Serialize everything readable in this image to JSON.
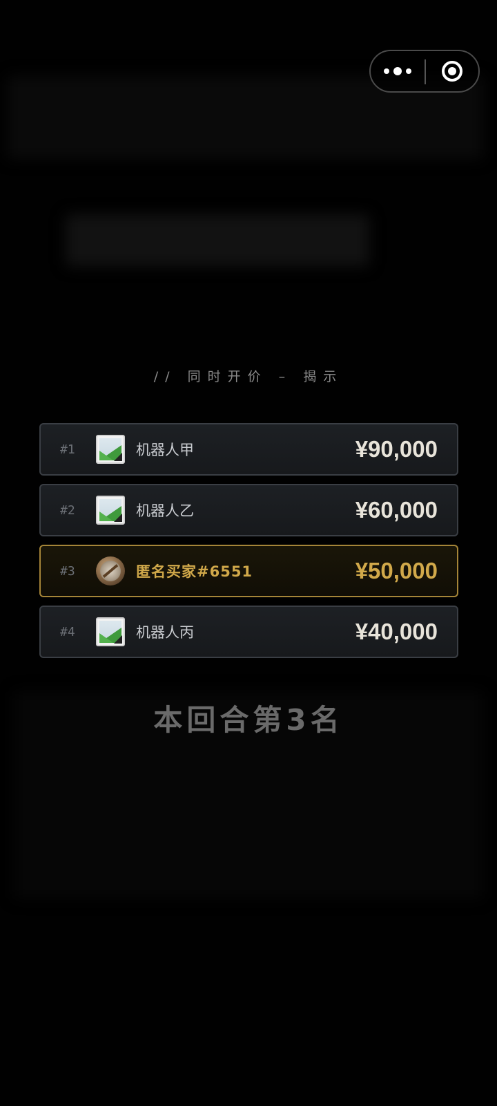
{
  "capsule": {
    "more_icon": "more-dots-icon",
    "close_icon": "target-circle-icon"
  },
  "reveal": {
    "title": "// 同时开价 – 揭示"
  },
  "ranking": [
    {
      "rank": "#1",
      "name": "机器人甲",
      "price": "¥90,000",
      "avatar": "image-placeholder-icon",
      "is_me": false
    },
    {
      "rank": "#2",
      "name": "机器人乙",
      "price": "¥60,000",
      "avatar": "image-placeholder-icon",
      "is_me": false
    },
    {
      "rank": "#3",
      "name": "匿名买家#6551",
      "price": "¥50,000",
      "avatar": "coin-avatar-icon",
      "is_me": true
    },
    {
      "rank": "#4",
      "name": "机器人丙",
      "price": "¥40,000",
      "avatar": "image-placeholder-icon",
      "is_me": false
    }
  ],
  "result": {
    "text": "本回合第3名"
  },
  "colors": {
    "highlight": "#d1a94a",
    "row_border": "#3a3e44",
    "background": "#010101"
  }
}
